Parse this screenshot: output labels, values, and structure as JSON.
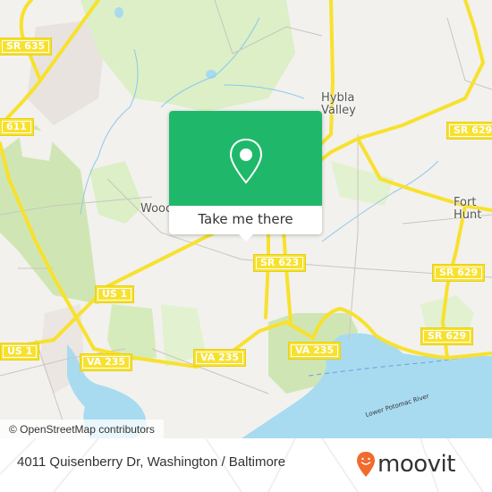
{
  "map": {
    "attribution": "© OpenStreetMap contributors",
    "place_labels": [
      {
        "name": "hybla-valley",
        "line1": "Hybla",
        "line2": "Valley"
      },
      {
        "name": "fort-hunt",
        "line1": "Fort",
        "line2": "Hunt"
      },
      {
        "name": "woodlawn-partial",
        "line1": "Wooc",
        "line2": ""
      }
    ],
    "road_shields": [
      {
        "name": "sr-635",
        "label": "SR 635"
      },
      {
        "name": "route-611",
        "label": "611"
      },
      {
        "name": "sr-629-north",
        "label": "SR 629"
      },
      {
        "name": "sr-623",
        "label": "SR 623"
      },
      {
        "name": "sr-629-mid",
        "label": "SR 629"
      },
      {
        "name": "us-1-east",
        "label": "US 1"
      },
      {
        "name": "us-1-west",
        "label": "US 1"
      },
      {
        "name": "sr-629-south",
        "label": "SR 629"
      },
      {
        "name": "va-235-center",
        "label": "VA 235"
      },
      {
        "name": "va-235-west",
        "label": "VA 235"
      },
      {
        "name": "va-235-mid",
        "label": "VA 235"
      }
    ],
    "water_label": "Lower Potomac River",
    "colors": {
      "land": "#f2f1ed",
      "park": "#d6ebbc",
      "water": "#a8dbf0",
      "road": "#f7e12e",
      "popup_green": "#1fb86a"
    }
  },
  "popup": {
    "icon": "location-pin-icon",
    "button_label": "Take me there"
  },
  "footer": {
    "address": "4011 Quisenberry Dr, Washington / Baltimore",
    "brand": "moovit",
    "brand_color": "#f26a2e"
  }
}
